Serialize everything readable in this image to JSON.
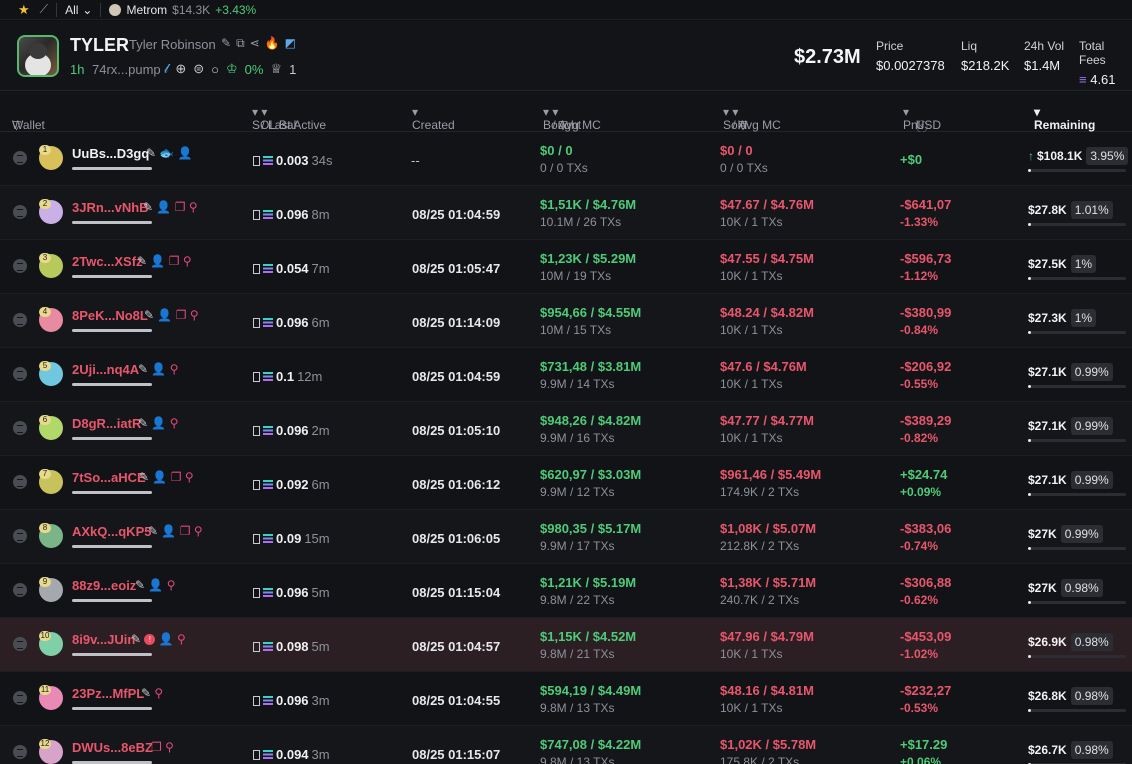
{
  "topbar": {
    "filter": "All",
    "token_name": "Metrom",
    "token_value": "$14.3K",
    "token_change": "+3.43%"
  },
  "token": {
    "symbol": "TYLER",
    "name": "Tyler Robinson",
    "age": "1h",
    "address": "74rx...pump",
    "holders_pct": "0%",
    "crowns": "1",
    "market_cap": "$2.73M",
    "stats": {
      "price_label": "Price",
      "price": "$0.0027378",
      "liq_label": "Liq",
      "liq": "$218.2K",
      "vol_label": "24h Vol",
      "vol": "$1.4M",
      "fees_label": "Total Fees",
      "fees": "4.61"
    }
  },
  "columns": {
    "wallet": "Wallet",
    "sol_bal": "SOL Bal",
    "last_active": "/ Last Active",
    "created": "Created",
    "bought": "Bought",
    "avg_mc_b": "/ Avg MC",
    "sold": "Sold",
    "avg_mc_s": "/ Avg MC",
    "pnl": "Pnl",
    "usd": "USD",
    "remaining": "Remaining"
  },
  "rows": [
    {
      "wallet": "UuBs...D3gq",
      "num": "1",
      "sol": "0.003",
      "ago": "34s",
      "created": "--",
      "bought": "$0",
      "bought_mc": "0",
      "bought_sub": "0 / 0 TXs",
      "sold": "$0",
      "sold_mc": "0",
      "sold_sub": "0 / 0 TXs",
      "pnl": "+$0",
      "pnl_pct": "",
      "remaining": "$108.1K",
      "rem_pct": "3.95%"
    },
    {
      "wallet": "3JRn...vNhB",
      "num": "2",
      "sol": "0.096",
      "ago": "8m",
      "created": "08/25 01:04:59",
      "bought": "$1,51K",
      "bought_mc": "$4.76M",
      "bought_sub": "10.1M / 26 TXs",
      "sold": "$47.67",
      "sold_mc": "$4.76M",
      "sold_sub": "10K / 1 TXs",
      "pnl": "-$641,07",
      "pnl_pct": "-1.33%",
      "remaining": "$27.8K",
      "rem_pct": "1.01%"
    },
    {
      "wallet": "2Twc...XSfz",
      "num": "3",
      "sol": "0.054",
      "ago": "7m",
      "created": "08/25 01:05:47",
      "bought": "$1,23K",
      "bought_mc": "$5.29M",
      "bought_sub": "10M / 19 TXs",
      "sold": "$47.55",
      "sold_mc": "$4.75M",
      "sold_sub": "10K / 1 TXs",
      "pnl": "-$596,73",
      "pnl_pct": "-1.12%",
      "remaining": "$27.5K",
      "rem_pct": "1%"
    },
    {
      "wallet": "8PeK...No8L",
      "num": "4",
      "sol": "0.096",
      "ago": "6m",
      "created": "08/25 01:14:09",
      "bought": "$954,66",
      "bought_mc": "$4.55M",
      "bought_sub": "10M / 15 TXs",
      "sold": "$48.24",
      "sold_mc": "$4.82M",
      "sold_sub": "10K / 1 TXs",
      "pnl": "-$380,99",
      "pnl_pct": "-0.84%",
      "remaining": "$27.3K",
      "rem_pct": "1%"
    },
    {
      "wallet": "2Uji...nq4A",
      "num": "5",
      "sol": "0.1",
      "ago": "12m",
      "created": "08/25 01:04:59",
      "bought": "$731,48",
      "bought_mc": "$3.81M",
      "bought_sub": "9.9M / 14 TXs",
      "sold": "$47.6",
      "sold_mc": "$4.76M",
      "sold_sub": "10K / 1 TXs",
      "pnl": "-$206,92",
      "pnl_pct": "-0.55%",
      "remaining": "$27.1K",
      "rem_pct": "0.99%"
    },
    {
      "wallet": "D8gR...iatR",
      "num": "6",
      "sol": "0.096",
      "ago": "2m",
      "created": "08/25 01:05:10",
      "bought": "$948,26",
      "bought_mc": "$4.82M",
      "bought_sub": "9.9M / 16 TXs",
      "sold": "$47.77",
      "sold_mc": "$4.77M",
      "sold_sub": "10K / 1 TXs",
      "pnl": "-$389,29",
      "pnl_pct": "-0.82%",
      "remaining": "$27.1K",
      "rem_pct": "0.99%"
    },
    {
      "wallet": "7tSo...aHCE",
      "num": "7",
      "sol": "0.092",
      "ago": "6m",
      "created": "08/25 01:06:12",
      "bought": "$620,97",
      "bought_mc": "$3.03M",
      "bought_sub": "9.9M / 12 TXs",
      "sold": "$961,46",
      "sold_mc": "$5.49M",
      "sold_sub": "174.9K / 2 TXs",
      "pnl": "+$24.74",
      "pnl_pct": "+0.09%",
      "remaining": "$27.1K",
      "rem_pct": "0.99%"
    },
    {
      "wallet": "AXkQ...qKP5",
      "num": "8",
      "sol": "0.09",
      "ago": "15m",
      "created": "08/25 01:06:05",
      "bought": "$980,35",
      "bought_mc": "$5.17M",
      "bought_sub": "9.9M / 17 TXs",
      "sold": "$1,08K",
      "sold_mc": "$5.07M",
      "sold_sub": "212.8K / 2 TXs",
      "pnl": "-$383,06",
      "pnl_pct": "-0.74%",
      "remaining": "$27K",
      "rem_pct": "0.99%"
    },
    {
      "wallet": "88z9...eoiz",
      "num": "9",
      "sol": "0.096",
      "ago": "5m",
      "created": "08/25 01:15:04",
      "bought": "$1,21K",
      "bought_mc": "$5.19M",
      "bought_sub": "9.8M / 22 TXs",
      "sold": "$1,38K",
      "sold_mc": "$5.71M",
      "sold_sub": "240.7K / 2 TXs",
      "pnl": "-$306,88",
      "pnl_pct": "-0.62%",
      "remaining": "$27K",
      "rem_pct": "0.98%"
    },
    {
      "wallet": "8i9v...JUin",
      "num": "10",
      "sol": "0.098",
      "ago": "5m",
      "created": "08/25 01:04:57",
      "bought": "$1,15K",
      "bought_mc": "$4.52M",
      "bought_sub": "9.8M / 21 TXs",
      "sold": "$47.96",
      "sold_mc": "$4.79M",
      "sold_sub": "10K / 1 TXs",
      "pnl": "-$453,09",
      "pnl_pct": "-1.02%",
      "remaining": "$26.9K",
      "rem_pct": "0.98%"
    },
    {
      "wallet": "23Pz...MfPL",
      "num": "11",
      "sol": "0.096",
      "ago": "3m",
      "created": "08/25 01:04:55",
      "bought": "$594,19",
      "bought_mc": "$4.49M",
      "bought_sub": "9.8M / 13 TXs",
      "sold": "$48.16",
      "sold_mc": "$4.81M",
      "sold_sub": "10K / 1 TXs",
      "pnl": "-$232,27",
      "pnl_pct": "-0.53%",
      "remaining": "$26.8K",
      "rem_pct": "0.98%"
    },
    {
      "wallet": "DWUs...8eBZ",
      "num": "12",
      "sol": "0.094",
      "ago": "3m",
      "created": "08/25 01:15:07",
      "bought": "$747,08",
      "bought_mc": "$4.22M",
      "bought_sub": "9.8M / 13 TXs",
      "sold": "$1,02K",
      "sold_mc": "$5.78M",
      "sold_sub": "175.8K / 2 TXs",
      "pnl": "+$17.29",
      "pnl_pct": "+0.06%",
      "remaining": "$26.7K",
      "rem_pct": "0.98%"
    }
  ]
}
